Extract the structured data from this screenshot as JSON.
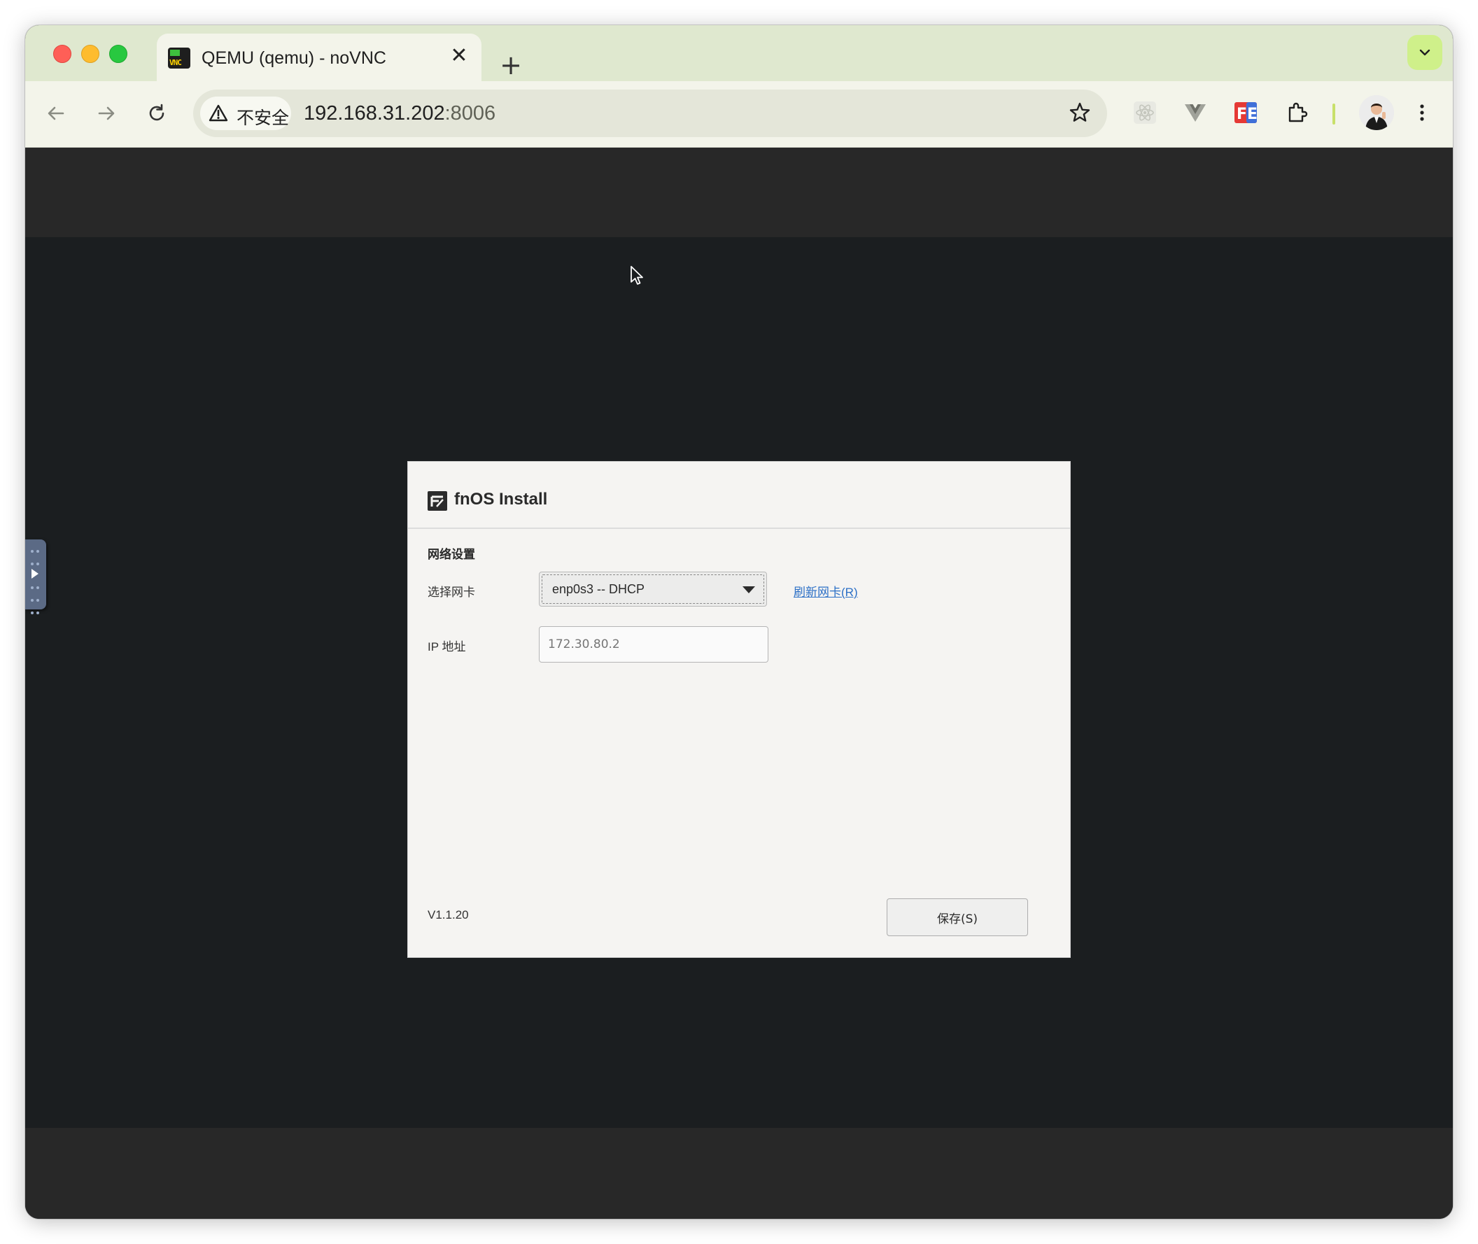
{
  "browser": {
    "tab": {
      "title": "QEMU (qemu) - noVNC",
      "favicon_text": "VNC",
      "favicon": "novnc-icon",
      "close_glyph": "✕"
    },
    "new_tab_glyph": "+",
    "address": {
      "security_label": "不安全",
      "host": "192.168.31.202",
      "port": ":8006"
    },
    "icons": {
      "back": "arrow-left-icon",
      "forward": "arrow-right-icon",
      "reload": "reload-icon",
      "bookmark": "star-icon",
      "extensions": [
        "react-devtools-icon",
        "vue-devtools-icon",
        "fehelper-icon",
        "puzzle-icon"
      ],
      "menu": "more-vertical-icon"
    }
  },
  "dialog": {
    "title": "fnOS Install",
    "section_title": "网络设置",
    "nic_label": "选择网卡",
    "nic_selected": "enp0s3 -- DHCP",
    "refresh_link": "刷新网卡(R)",
    "ip_label": "IP 地址",
    "ip_placeholder": "172.30.80.2",
    "version": "V1.1.20",
    "save_button": "保存(S)"
  },
  "colors": {
    "tabstrip": "#dfe8cf",
    "toolbar": "#f3f4ea",
    "vnc_background": "#1b1e20",
    "vnc_bars": "#282828",
    "dialog_background": "#f5f4f2",
    "link": "#2b6fc6"
  }
}
